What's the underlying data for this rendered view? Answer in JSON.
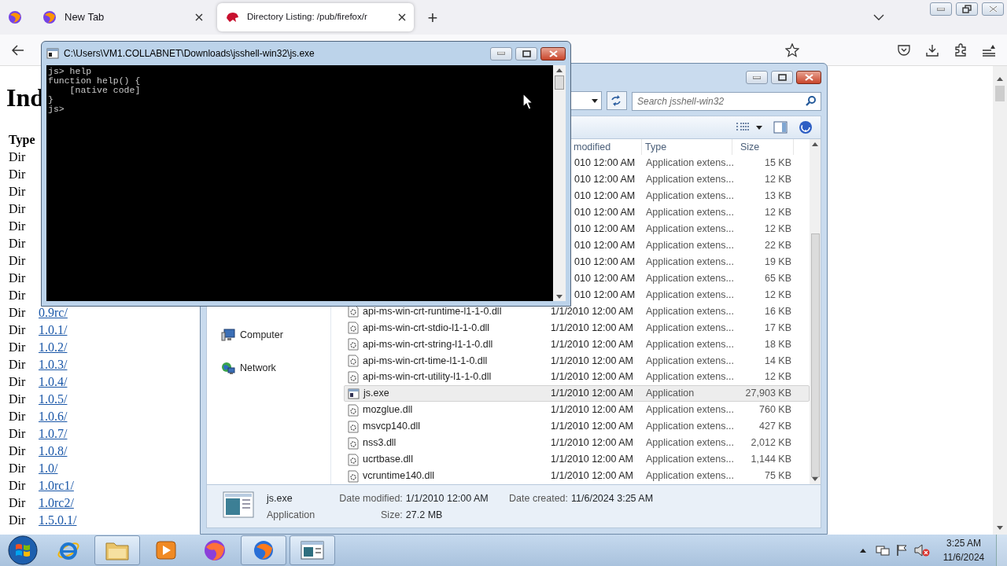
{
  "browser": {
    "tabs": [
      {
        "title": "New Tab",
        "selected": false
      },
      {
        "title": "Directory Listing: /pub/firefox/r",
        "selected": true
      }
    ],
    "new_tab": "+",
    "page": {
      "heading": "Ind",
      "type_header": "Type",
      "rows": [
        {
          "type": "Dir"
        },
        {
          "type": "Dir"
        },
        {
          "type": "Dir"
        },
        {
          "type": "Dir"
        },
        {
          "type": "Dir"
        },
        {
          "type": "Dir"
        },
        {
          "type": "Dir"
        },
        {
          "type": "Dir"
        },
        {
          "type": "Dir"
        },
        {
          "type": "Dir",
          "name": "0.9rc/"
        },
        {
          "type": "Dir",
          "name": "1.0.1/"
        },
        {
          "type": "Dir",
          "name": "1.0.2/"
        },
        {
          "type": "Dir",
          "name": "1.0.3/"
        },
        {
          "type": "Dir",
          "name": "1.0.4/"
        },
        {
          "type": "Dir",
          "name": "1.0.5/"
        },
        {
          "type": "Dir",
          "name": "1.0.6/"
        },
        {
          "type": "Dir",
          "name": "1.0.7/"
        },
        {
          "type": "Dir",
          "name": "1.0.8/"
        },
        {
          "type": "Dir",
          "name": "1.0/"
        },
        {
          "type": "Dir",
          "name": "1.0rc1/"
        },
        {
          "type": "Dir",
          "name": "1.0rc2/"
        },
        {
          "type": "Dir",
          "name": "1.5.0.1/"
        }
      ]
    }
  },
  "explorer": {
    "search_placeholder": "Search jsshell-win32",
    "nav_items": [
      {
        "label": "Computer",
        "kind": "computer"
      },
      {
        "label": "Network",
        "kind": "network"
      }
    ],
    "columns": [
      "modified",
      "Type",
      "Size"
    ],
    "files": [
      {
        "date": "010 12:00 AM",
        "type": "Application extens...",
        "size": "15 KB",
        "selected": false
      },
      {
        "date": "010 12:00 AM",
        "type": "Application extens...",
        "size": "12 KB",
        "selected": false
      },
      {
        "date": "010 12:00 AM",
        "type": "Application extens...",
        "size": "13 KB",
        "selected": false
      },
      {
        "date": "010 12:00 AM",
        "type": "Application extens...",
        "size": "12 KB",
        "selected": false
      },
      {
        "date": "010 12:00 AM",
        "type": "Application extens...",
        "size": "12 KB",
        "selected": false
      },
      {
        "date": "010 12:00 AM",
        "type": "Application extens...",
        "size": "22 KB",
        "selected": false
      },
      {
        "date": "010 12:00 AM",
        "type": "Application extens...",
        "size": "19 KB",
        "selected": false
      },
      {
        "date": "010 12:00 AM",
        "type": "Application extens...",
        "size": "65 KB",
        "selected": false
      },
      {
        "date": "010 12:00 AM",
        "type": "Application extens...",
        "size": "12 KB",
        "selected": false
      },
      {
        "kind": "dll",
        "name": "api-ms-win-crt-runtime-l1-1-0.dll",
        "date": "1/1/2010 12:00 AM",
        "type": "Application extens...",
        "size": "16 KB",
        "selected": false
      },
      {
        "kind": "dll",
        "name": "api-ms-win-crt-stdio-l1-1-0.dll",
        "date": "1/1/2010 12:00 AM",
        "type": "Application extens...",
        "size": "17 KB",
        "selected": false
      },
      {
        "kind": "dll",
        "name": "api-ms-win-crt-string-l1-1-0.dll",
        "date": "1/1/2010 12:00 AM",
        "type": "Application extens...",
        "size": "18 KB",
        "selected": false
      },
      {
        "kind": "dll",
        "name": "api-ms-win-crt-time-l1-1-0.dll",
        "date": "1/1/2010 12:00 AM",
        "type": "Application extens...",
        "size": "14 KB",
        "selected": false
      },
      {
        "kind": "dll",
        "name": "api-ms-win-crt-utility-l1-1-0.dll",
        "date": "1/1/2010 12:00 AM",
        "type": "Application extens...",
        "size": "12 KB",
        "selected": false
      },
      {
        "kind": "exe",
        "name": "js.exe",
        "date": "1/1/2010 12:00 AM",
        "type": "Application",
        "size": "27,903 KB",
        "selected": true
      },
      {
        "kind": "dll",
        "name": "mozglue.dll",
        "date": "1/1/2010 12:00 AM",
        "type": "Application extens...",
        "size": "760 KB",
        "selected": false
      },
      {
        "kind": "dll",
        "name": "msvcp140.dll",
        "date": "1/1/2010 12:00 AM",
        "type": "Application extens...",
        "size": "427 KB",
        "selected": false
      },
      {
        "kind": "dll",
        "name": "nss3.dll",
        "date": "1/1/2010 12:00 AM",
        "type": "Application extens...",
        "size": "2,012 KB",
        "selected": false
      },
      {
        "kind": "dll",
        "name": "ucrtbase.dll",
        "date": "1/1/2010 12:00 AM",
        "type": "Application extens...",
        "size": "1,144 KB",
        "selected": false
      },
      {
        "kind": "dll",
        "name": "vcruntime140.dll",
        "date": "1/1/2010 12:00 AM",
        "type": "Application extens...",
        "size": "75 KB",
        "selected": false
      }
    ],
    "details": {
      "name": "js.exe",
      "type": "Application",
      "fields": [
        {
          "label": "Date modified:",
          "value": "1/1/2010 12:00 AM"
        },
        {
          "label": "Size:",
          "value": "27.2 MB"
        },
        {
          "label": "Date created:",
          "value": "11/6/2024 3:25 AM"
        }
      ]
    }
  },
  "console": {
    "title": "C:\\Users\\VM1.COLLABNET\\Downloads\\jsshell-win32\\js.exe",
    "lines": [
      "js> help",
      "function help() {",
      "    [native code]",
      "}",
      "js>"
    ]
  },
  "taskbar": {
    "apps": [
      {
        "kind": "ie",
        "open": false
      },
      {
        "kind": "folder",
        "open": true
      },
      {
        "kind": "media",
        "open": false
      },
      {
        "kind": "firefox",
        "open": false
      },
      {
        "kind": "firefox-dev",
        "open": true
      },
      {
        "kind": "console",
        "open": true
      }
    ],
    "time": "3:25 AM",
    "date": "11/6/2024"
  }
}
